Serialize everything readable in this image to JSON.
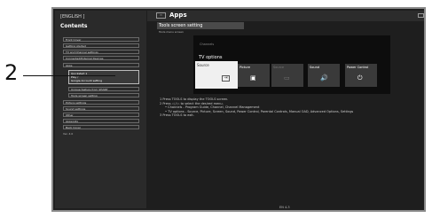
{
  "sidebar": {
    "language": "[ENGLISH ]",
    "title": "Contents",
    "items": [
      {
        "label": "Front Cover"
      },
      {
        "label": "Getting started"
      },
      {
        "label": "TV and Channel settings"
      },
      {
        "label": "Connected/External Devices"
      },
      {
        "label": "Apps"
      }
    ],
    "highlight": {
      "line1": "Quickstart 1",
      "line2": "Play /",
      "line3": "Google Account setting"
    },
    "subitems": [
      {
        "label": "Unique feature from SHARP"
      },
      {
        "label": "Tools screen setting"
      }
    ],
    "items2": [
      {
        "label": "Picture settings"
      },
      {
        "label": "Sound settings"
      },
      {
        "label": "Other"
      },
      {
        "label": "Appendix"
      },
      {
        "label": "Back Cover"
      }
    ],
    "version": "Ver. 4.0"
  },
  "topbar": {
    "icon_text": "▭",
    "title": "Apps"
  },
  "section": {
    "title": "Tools screen setting",
    "subtitle": "Tools menu screen"
  },
  "panel": {
    "channels_label": "Channels",
    "tv_options_label": "TV options",
    "options": [
      {
        "label": "Source",
        "icon": "input-icon",
        "glyph": "⇥"
      },
      {
        "label": "Picture",
        "icon": "picture-icon",
        "glyph": "▣"
      },
      {
        "label": "Source",
        "icon": "screen-icon",
        "glyph": "▭"
      },
      {
        "label": "Sound",
        "icon": "sound-icon",
        "glyph": "🔊"
      },
      {
        "label": "Power Control",
        "icon": "power-plug-icon",
        "glyph": "⏻"
      }
    ]
  },
  "steps": [
    "1 Press TOOLS to display the TOOLS screen.",
    "2 Press ◁ / ▷ to select the desired menu.",
    "• Channels - Program Guide, Channel, Channel Management",
    "• TV options - Source, Picture, Screen, Sound, Power Control, Parental Controls, Manual OAD, Advanced Options, Settings",
    "3 Press TOOLS to exit."
  ],
  "page_number": "EN 4-3",
  "callout": {
    "number": "2"
  }
}
